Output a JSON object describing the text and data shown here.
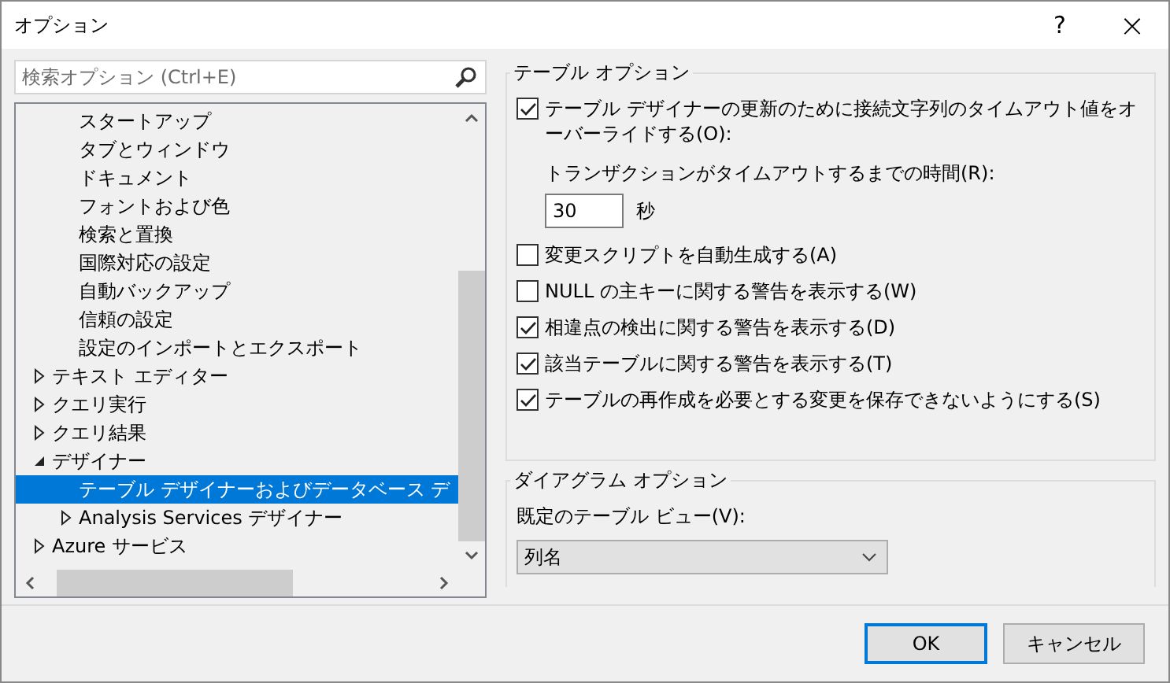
{
  "window": {
    "title": "オプション",
    "help": "?",
    "close": "×"
  },
  "search": {
    "placeholder": "検索オプション (Ctrl+E)"
  },
  "tree": {
    "continued_items": [
      {
        "label": "スタートアップ"
      },
      {
        "label": "タブとウィンドウ"
      },
      {
        "label": "ドキュメント"
      },
      {
        "label": "フォントおよび色"
      },
      {
        "label": "検索と置換"
      },
      {
        "label": "国際対応の設定"
      },
      {
        "label": "自動バックアップ"
      },
      {
        "label": "信頼の設定"
      },
      {
        "label": "設定のインポートとエクスポート"
      }
    ],
    "items": [
      {
        "label": "テキスト エディター",
        "expanded": false,
        "selected": false
      },
      {
        "label": "クエリ実行",
        "expanded": false,
        "selected": false
      },
      {
        "label": "クエリ結果",
        "expanded": false,
        "selected": false
      },
      {
        "label": "デザイナー",
        "expanded": true,
        "selected": false,
        "children": [
          {
            "label": "テーブル デザイナーおよびデータベース デ",
            "selected": true
          },
          {
            "label": "Analysis Services デザイナー",
            "expanded": false,
            "selected": false
          }
        ]
      },
      {
        "label": "Azure サービス",
        "expanded": false,
        "selected": false
      }
    ]
  },
  "table_options": {
    "title": "テーブル オプション",
    "options": [
      {
        "kind": "checkbox",
        "label": "テーブル デザイナーの更新のために接続文字列のタイムアウト値をオーバーライドする(O):",
        "checked": true
      },
      {
        "kind": "field",
        "label": "トランザクションがタイムアウトするまでの時間(R):",
        "value": "30",
        "unit": "秒"
      },
      {
        "kind": "checkbox",
        "label": "変更スクリプトを自動生成する(A)",
        "checked": false
      },
      {
        "kind": "checkbox",
        "label": "NULL の主キーに関する警告を表示する(W)",
        "checked": false
      },
      {
        "kind": "checkbox",
        "label": "相違点の検出に関する警告を表示する(D)",
        "checked": true
      },
      {
        "kind": "checkbox",
        "label": "該当テーブルに関する警告を表示する(T)",
        "checked": true
      },
      {
        "kind": "checkbox",
        "label": "テーブルの再作成を必要とする変更を保存できないようにする(S)",
        "checked": true
      }
    ]
  },
  "diagram_options": {
    "title": "ダイアグラム オプション",
    "label": "既定のテーブル ビュー(V):",
    "value": "列名"
  },
  "buttons": [
    {
      "label": "OK",
      "kind": "default"
    },
    {
      "label": "キャンセル",
      "kind": "normal"
    }
  ]
}
